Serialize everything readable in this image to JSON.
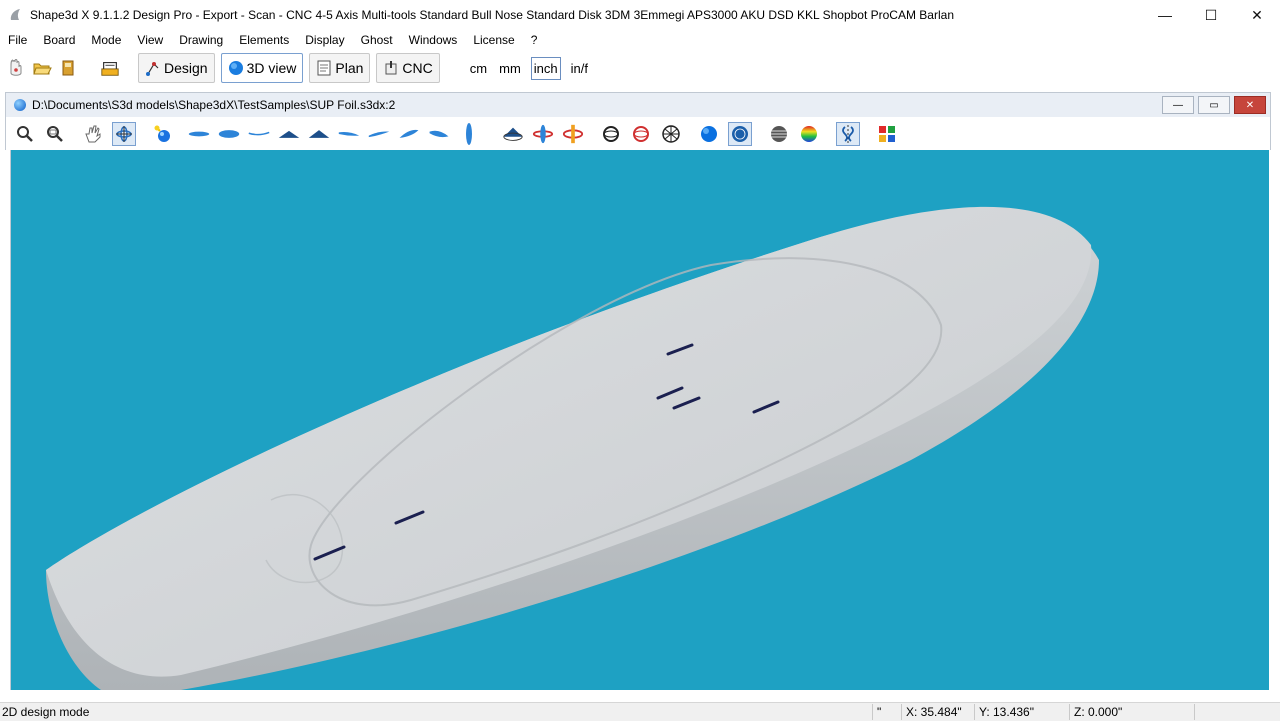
{
  "window": {
    "title": "Shape3d X 9.1.1.2 Design Pro - Export - Scan - CNC 4-5 Axis Multi-tools  Standard Bull Nose Standard Disk 3DM 3Emmegi APS3000 AKU DSD KKL Shopbot ProCAM Barlan",
    "controls": {
      "minimize": "—",
      "maximize": "☐",
      "close": "✕"
    }
  },
  "menu": [
    "File",
    "Board",
    "Mode",
    "View",
    "Drawing",
    "Elements",
    "Display",
    "Ghost",
    "Windows",
    "License",
    "?"
  ],
  "toolbar": {
    "icons": [
      "pointer-icon",
      "open-folder-icon",
      "save-icon",
      "scan-icon"
    ],
    "modes": [
      {
        "label": "Design",
        "icon": "design-icon"
      },
      {
        "label": "3D view",
        "icon": "globe-icon",
        "active": true
      },
      {
        "label": "Plan",
        "icon": "plan-icon"
      },
      {
        "label": "CNC",
        "icon": "cnc-icon"
      }
    ],
    "units": [
      {
        "label": "cm"
      },
      {
        "label": "mm"
      },
      {
        "label": "inch",
        "active": true
      },
      {
        "label": "in/f"
      }
    ]
  },
  "document": {
    "path": "D:\\Documents\\S3d models\\Shape3dX\\TestSamples\\SUP Foil.s3dx:2",
    "controls": {
      "minimize": "—",
      "restore": "▭",
      "close": "✕"
    }
  },
  "view_toolbar": {
    "icons": [
      "zoom-icon",
      "zoom-window-icon",
      "pan-hand-icon",
      "rotate-view-icon",
      "light-icon",
      "board-top-icon",
      "board-bottom-icon",
      "rocker-icon",
      "profile-icon",
      "deck-icon",
      "side-left-icon",
      "side-right-icon",
      "fin-icon",
      "outline-icon",
      "vertical-icon",
      "rotate-x-icon",
      "rotate-y-icon",
      "rotate-z-icon",
      "wire-ring-icon",
      "red-ring-icon",
      "mesh-sphere-icon",
      "blue-sphere-icon",
      "shaded-sphere-icon",
      "striped-sphere-icon",
      "rainbow-sphere-icon",
      "symmetry-icon",
      "color-grid-icon"
    ],
    "pressed": [
      "rotate-view-icon",
      "shaded-sphere-icon",
      "symmetry-icon"
    ]
  },
  "viewport": {
    "background": "#1ea1c3",
    "board_color": "#d3d6d9"
  },
  "status": {
    "mode": "2D design mode",
    "unit_mark": "\"",
    "x": "X: 35.484\"",
    "y": "Y: 13.436\"",
    "z": "Z: 0.000\""
  }
}
